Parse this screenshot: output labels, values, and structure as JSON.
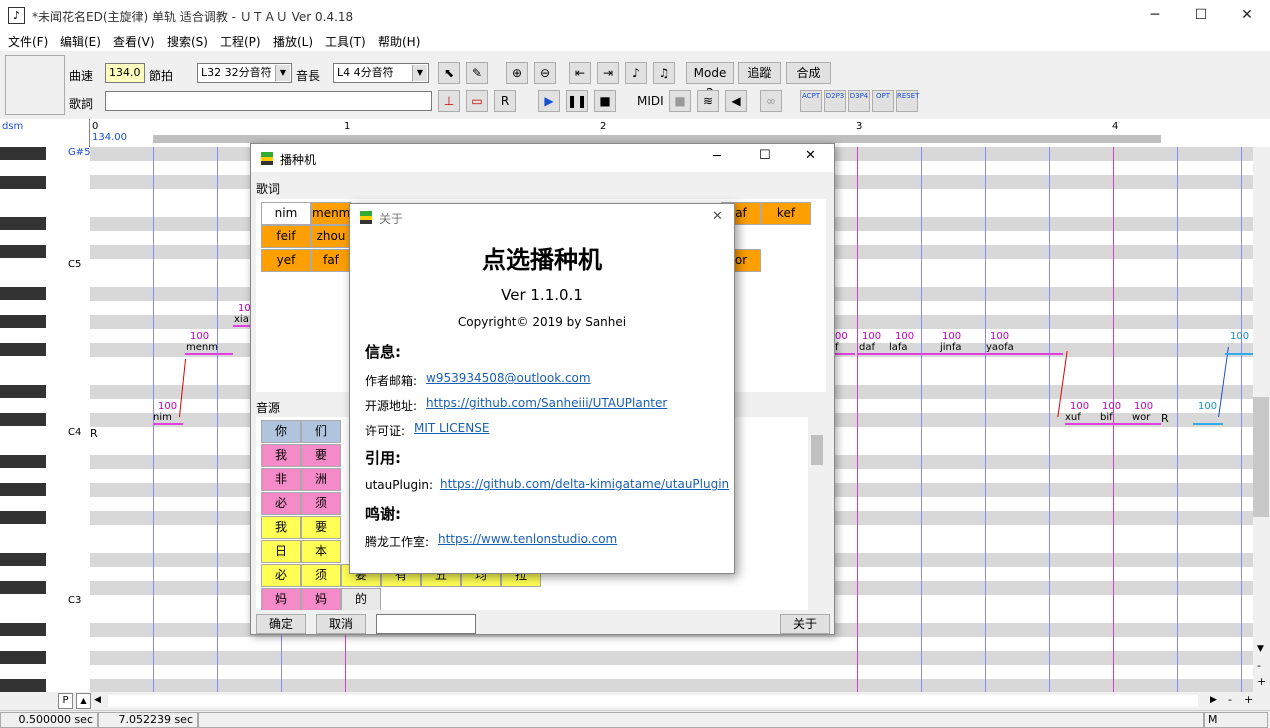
{
  "window": {
    "title": "*未闻花名ED(主旋律) 单轨 适合调教 - ＵＴＡＵ Ver 0.4.18",
    "app_icon": "♪",
    "min": "─",
    "max": "☐",
    "close": "✕"
  },
  "menu": [
    "文件(F)",
    "编辑(E)",
    "查看(V)",
    "搜索(S)",
    "工程(P)",
    "播放(L)",
    "工具(T)",
    "帮助(H)"
  ],
  "toolbar": {
    "tempo_label": "曲速",
    "tempo_value": "134.0",
    "beat_label": "節拍",
    "quantize": "L32 32分音符",
    "length_label": "音長",
    "length": "L4  4分音符",
    "lyric_label": "歌詞",
    "lyric_value": "",
    "mode": "Mode 2",
    "track": "追蹤",
    "render": "合成",
    "midi": "MIDI",
    "plugin_buttons": [
      "ACPT",
      "D2P3",
      "D3P4",
      "OPT",
      "RESET"
    ]
  },
  "ruler": {
    "track_name": "dsm",
    "tempo": "134.00",
    "measures": [
      "0",
      "1",
      "2",
      "3",
      "4"
    ]
  },
  "piano": {
    "labels": [
      "G#5",
      "C5",
      "C4",
      "C3"
    ]
  },
  "notes": [
    {
      "lyric": "nim",
      "vel": "100"
    },
    {
      "lyric": "menm",
      "vel": "100"
    },
    {
      "lyric": "xia",
      "vel": "10"
    },
    {
      "lyric": "f",
      "vel": "00"
    },
    {
      "lyric": "daf",
      "vel": "100"
    },
    {
      "lyric": "lafa",
      "vel": "100"
    },
    {
      "lyric": "jinfa",
      "vel": "100"
    },
    {
      "lyric": "yaofa",
      "vel": "100"
    },
    {
      "lyric": "xuf",
      "vel": "100"
    },
    {
      "lyric": "bif",
      "vel": "100"
    },
    {
      "lyric": "wor",
      "vel": "100"
    },
    {
      "lyric": "",
      "vel": "100"
    },
    {
      "lyric": "",
      "vel": "100"
    }
  ],
  "rests": [
    "R",
    "R"
  ],
  "status": {
    "left": "0.500000 sec",
    "mid": "7.052239 sec",
    "mode": "M"
  },
  "scroll": {
    "p": "P",
    "up": "▲",
    "down": "▼",
    "left": "◀",
    "right": "▶",
    "plus": "+",
    "minus": "-"
  },
  "planter": {
    "title": "播种机",
    "lyrics_label": "歌词",
    "lyrics_row1": [
      "nim",
      "menm",
      "af",
      "kef"
    ],
    "lyrics_row2": [
      "feif",
      "zhou"
    ],
    "lyrics_row3": [
      "yef",
      "faf",
      "or"
    ],
    "source_label": "音源",
    "source_rows": [
      [
        "你",
        "们"
      ],
      [
        "我",
        "要"
      ],
      [
        "非",
        "洲"
      ],
      [
        "必",
        "须"
      ],
      [
        "我",
        "要"
      ],
      [
        "日",
        "本"
      ],
      [
        "必",
        "须",
        "要",
        "有",
        "五",
        "均",
        "拉"
      ],
      [
        "妈",
        "妈",
        "的"
      ]
    ],
    "ok": "确定",
    "cancel": "取消",
    "about": "关于",
    "input": ""
  },
  "about": {
    "title": "关于",
    "heading": "点选播种机",
    "version": "Ver 1.1.0.1",
    "copyright": "Copyright© 2019 by Sanhei",
    "info_h": "信息:",
    "email_label": "作者邮箱:",
    "email": "w953934508@outlook.com",
    "src_label": "开源地址:",
    "src": "https://github.com/Sanheiii/UTAUPlanter",
    "lic_label": "许可证:",
    "lic": "MIT LICENSE",
    "ref_h": "引用:",
    "plugin_label": "utauPlugin:",
    "plugin": "https://github.com/delta-kimigatame/utauPlugin",
    "thanks_h": "鸣谢:",
    "studio_label": "腾龙工作室:",
    "studio": "https://www.tenlonstudio.com"
  }
}
